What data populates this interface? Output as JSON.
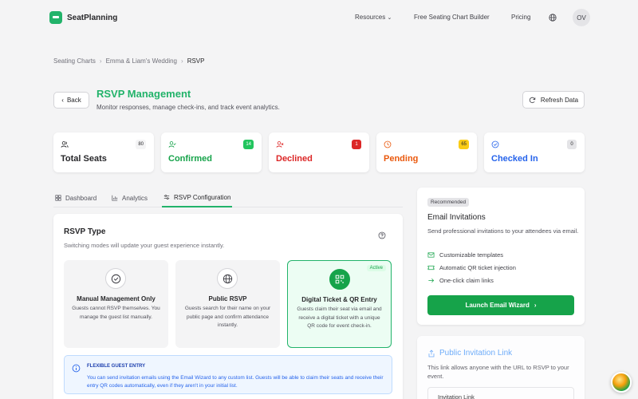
{
  "nav": {
    "brand": "SeatPlanning",
    "links": [
      "Resources",
      "Free Seating Chart Builder",
      "Pricing"
    ],
    "avatar": "OV"
  },
  "breadcrumb": [
    "Seating Charts",
    "Emma & Liam's Wedding",
    "RSVP"
  ],
  "header": {
    "back": "Back",
    "title": "RSVP Management",
    "subtitle": "Monitor responses, manage check-ins, and track event analytics.",
    "refresh": "Refresh Data"
  },
  "stats": [
    {
      "label": "Total Seats",
      "count": "80",
      "icon": "users-icon",
      "color": "#27272a",
      "badge_bg": "#f4f4f5",
      "badge_fg": "#27272a"
    },
    {
      "label": "Confirmed",
      "count": "14",
      "icon": "user-check-icon",
      "color": "#16a34a",
      "badge_bg": "#22c55e",
      "badge_fg": "#ffffff"
    },
    {
      "label": "Declined",
      "count": "1",
      "icon": "user-x-icon",
      "color": "#dc2626",
      "badge_bg": "#dc2626",
      "badge_fg": "#ffffff"
    },
    {
      "label": "Pending",
      "count": "65",
      "icon": "clock-icon",
      "color": "#ea580c",
      "badge_bg": "#facc15",
      "badge_fg": "#27272a"
    },
    {
      "label": "Checked In",
      "count": "0",
      "icon": "check-circle-icon",
      "color": "#2563eb",
      "badge_bg": "#e4e4e7",
      "badge_fg": "#27272a"
    }
  ],
  "tabs": [
    "Dashboard",
    "Analytics",
    "RSVP Configuration"
  ],
  "rsvp_type": {
    "title": "RSVP Type",
    "subtitle": "Switching modes will update your guest experience instantly.",
    "options": [
      {
        "title": "Manual Management Only",
        "desc": "Guests cannot RSVP themselves. You manage the guest list manually.",
        "icon": "check-circle-icon"
      },
      {
        "title": "Public RSVP",
        "desc": "Guests search for their name on your public page and confirm attendance instantly.",
        "icon": "globe-icon"
      },
      {
        "title": "Digital Ticket & QR Entry",
        "desc": "Guests claim their seat via email and receive a digital ticket with a unique QR code for event check-in.",
        "icon": "qr-code-icon",
        "tag": "Active"
      }
    ],
    "info_title": "FLEXIBLE GUEST ENTRY",
    "info_text": "You can send invitation emails using the Email Wizard to any custom list. Guests will be able to claim their seats and receive their entry QR codes automatically, even if they aren't in your initial list."
  },
  "email": {
    "tag": "Recommended",
    "title": "Email Invitations",
    "subtitle": "Send professional invitations to your attendees via email.",
    "features": [
      "Customizable templates",
      "Automatic QR ticket injection",
      "One-click claim links"
    ],
    "button": "Launch Email Wizard"
  },
  "public_link": {
    "title": "Public Invitation Link",
    "subtitle": "This link allows anyone with the URL to RSVP to your event.",
    "field_label": "Invitation Link"
  },
  "colors": {
    "accent": "#22b36a",
    "accent_dark": "#16a34a",
    "info": "#2563eb"
  }
}
